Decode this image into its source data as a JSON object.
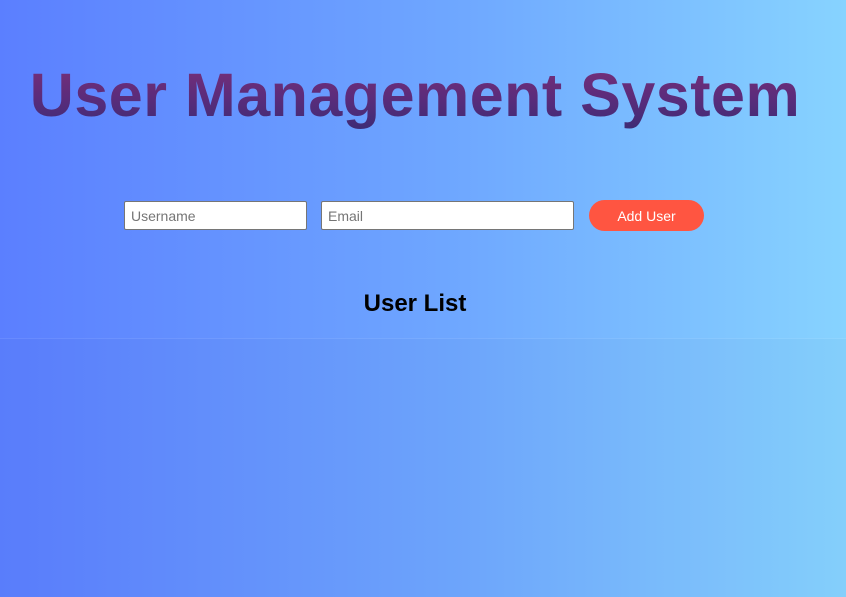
{
  "header": {
    "title": "User Management System"
  },
  "form": {
    "username_placeholder": "Username",
    "username_value": "",
    "email_placeholder": "Email",
    "email_value": "",
    "add_button_label": "Add User"
  },
  "user_list": {
    "title": "User List",
    "users": []
  },
  "colors": {
    "background_start": "#5b7fff",
    "background_end": "#87d3ff",
    "title_gradient_top": "#7d2f78",
    "title_gradient_bottom": "#3b2b74",
    "add_button": "#ff5541"
  }
}
